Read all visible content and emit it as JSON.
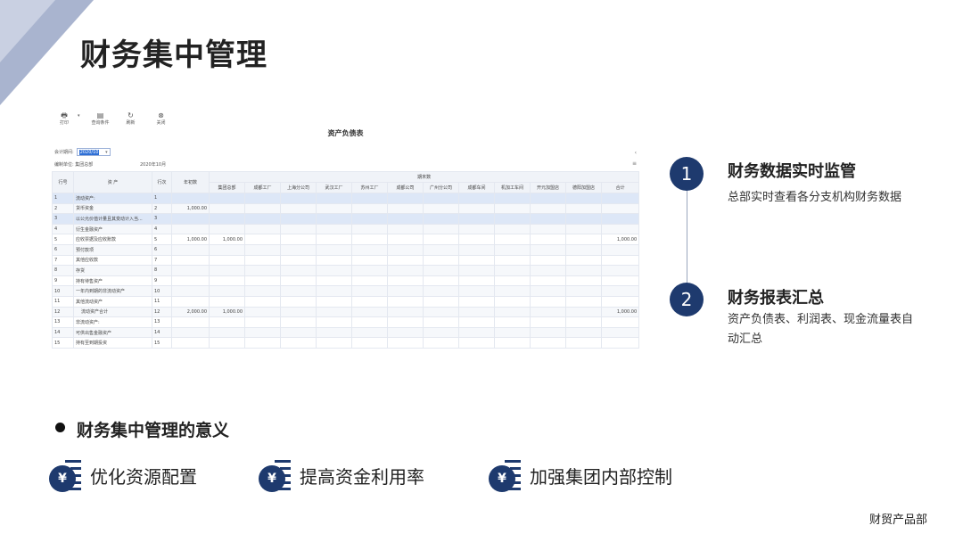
{
  "slide": {
    "title": "财务集中管理",
    "footer": "财贸产品部"
  },
  "screenshot": {
    "toolbar": [
      {
        "icon": "printer-icon",
        "glyph": "🖶",
        "label": "打印"
      },
      {
        "icon": "filter-icon",
        "glyph": "▤",
        "label": "查询条件"
      },
      {
        "icon": "refresh-icon",
        "glyph": "↻",
        "label": "刷新"
      },
      {
        "icon": "close-icon",
        "glyph": "⊗",
        "label": "关闭"
      }
    ],
    "report_title": "资产负债表",
    "period_label": "会计期间:",
    "period_value": "2020/10",
    "unit_label": "编制单位: 集团总部",
    "date": "2020年10月",
    "side_icons": [
      "‹",
      "≡"
    ],
    "table": {
      "h_row": "行号",
      "h_asset": "资 产",
      "h_line": "行次",
      "h_begin": "年初数",
      "h_end_group": "期末数",
      "companies": [
        "集团总部",
        "成都工厂",
        "上海分公司",
        "武汉工厂",
        "苏州工厂",
        "成都公司",
        "广州分公司",
        "成都车间",
        "机加工车间",
        "开元加盟店",
        "德阳加盟店",
        "合计"
      ],
      "rows": [
        {
          "no": "1",
          "name": "流动资产:",
          "line": "1",
          "begin": "",
          "hq": "",
          "total": ""
        },
        {
          "no": "2",
          "name": "货币资金",
          "line": "2",
          "begin": "1,000.00",
          "hq": "",
          "total": ""
        },
        {
          "no": "3",
          "name": "以公允价值计量且其变动计入当...",
          "line": "3",
          "begin": "",
          "hq": "",
          "total": ""
        },
        {
          "no": "4",
          "name": "衍生金融资产",
          "line": "4",
          "begin": "",
          "hq": "",
          "total": ""
        },
        {
          "no": "5",
          "name": "应收票据及应收账款",
          "line": "5",
          "begin": "1,000.00",
          "hq": "1,000.00",
          "total": "1,000.00"
        },
        {
          "no": "6",
          "name": "预付款项",
          "line": "6",
          "begin": "",
          "hq": "",
          "total": ""
        },
        {
          "no": "7",
          "name": "其他应收款",
          "line": "7",
          "begin": "",
          "hq": "",
          "total": ""
        },
        {
          "no": "8",
          "name": "存货",
          "line": "8",
          "begin": "",
          "hq": "",
          "total": ""
        },
        {
          "no": "9",
          "name": "持有待售资产",
          "line": "9",
          "begin": "",
          "hq": "",
          "total": ""
        },
        {
          "no": "10",
          "name": "一年内到期的非流动资产",
          "line": "10",
          "begin": "",
          "hq": "",
          "total": ""
        },
        {
          "no": "11",
          "name": "其他流动资产",
          "line": "11",
          "begin": "",
          "hq": "",
          "total": ""
        },
        {
          "no": "12",
          "name": "流动资产合计",
          "line": "12",
          "begin": "2,000.00",
          "hq": "1,000.00",
          "total": "1,000.00"
        },
        {
          "no": "13",
          "name": "非流动资产:",
          "line": "13",
          "begin": "",
          "hq": "",
          "total": ""
        },
        {
          "no": "14",
          "name": "可供出售金融资产",
          "line": "14",
          "begin": "",
          "hq": "",
          "total": ""
        },
        {
          "no": "15",
          "name": "持有至到期投资",
          "line": "15",
          "begin": "",
          "hq": "",
          "total": ""
        }
      ]
    }
  },
  "points": [
    {
      "num": "1",
      "title": "财务数据实时监管",
      "desc": "总部实时查看各分支机构财务数据"
    },
    {
      "num": "2",
      "title": "财务报表汇总",
      "desc": "资产负债表、利润表、现金流量表自动汇总"
    }
  ],
  "significance": {
    "title": "财务集中管理的意义",
    "items": [
      {
        "icon": "yen-ledger-icon",
        "symbol": "¥",
        "label": "优化资源配置"
      },
      {
        "icon": "yen-ledger-icon",
        "symbol": "¥",
        "label": "提高资金利用率"
      },
      {
        "icon": "yen-ledger-icon",
        "symbol": "¥",
        "label": "加强集团内部控制"
      }
    ]
  },
  "colors": {
    "navy": "#1e3a6e",
    "selection": "#2d6fd6",
    "deco": "#a9b4cf"
  }
}
